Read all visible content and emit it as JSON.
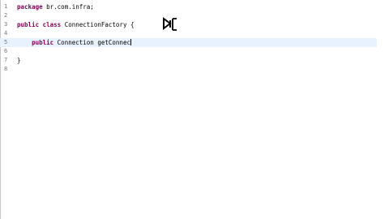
{
  "editor": {
    "lines": [
      {
        "number": "1",
        "text": "package br.com.infra;"
      },
      {
        "number": "2",
        "text": ""
      },
      {
        "number": "3",
        "text": "public class ConnectionFactory {"
      },
      {
        "number": "4",
        "text": ""
      },
      {
        "number": "5",
        "text": "    public Connection getConnec"
      },
      {
        "number": "6",
        "text": ""
      },
      {
        "number": "7",
        "text": "}"
      },
      {
        "number": "8",
        "text": ""
      }
    ],
    "current_line": "5",
    "keywords": [
      "package",
      "public",
      "class"
    ],
    "colors": {
      "keyword": "#7f0055",
      "line_number": "#787878",
      "current_line_highlight": "#e8f2fe"
    },
    "cursor_icon": "pointer-cursor-icon"
  }
}
